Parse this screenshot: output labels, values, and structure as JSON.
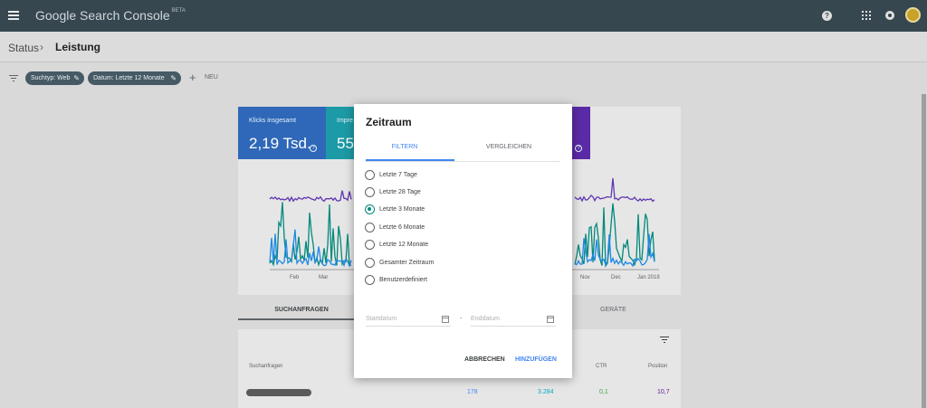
{
  "app": {
    "title": "Google Search Console",
    "beta": "BETA"
  },
  "breadcrumb": {
    "parent": "Status",
    "separator": "›",
    "current": "Leistung"
  },
  "filters": {
    "chips": [
      {
        "label": "Suchtyp: Web"
      },
      {
        "label": "Datum: Letzte 12 Monate"
      }
    ],
    "add_label": "NEU"
  },
  "metrics": [
    {
      "label": "Klicks insgesamt",
      "value": "2,19 Tsd.",
      "color": "#4285f4"
    },
    {
      "label": "Impre",
      "value": "55",
      "color": "#00acc1"
    }
  ],
  "chart_data": {
    "type": "line",
    "x_tick_labels": [
      "Feb",
      "Mar",
      "Nov",
      "Dec",
      "Jan 2018"
    ],
    "series": [
      {
        "color": "#5e35b1"
      },
      {
        "color": "#00897b"
      },
      {
        "color": "#1e88e5"
      }
    ]
  },
  "table_section": {
    "tabs": {
      "queries": "SUCHANFRAGEN",
      "devices": "GERÄTE"
    },
    "columns": {
      "query": "Suchanfragen",
      "ctr": "CTR",
      "position": "Position"
    },
    "first_row": {
      "clicks": "178",
      "impressions": "3.284",
      "ctr": "0,1",
      "position": "10,7"
    }
  },
  "modal": {
    "title": "Zeitraum",
    "tabs": {
      "filter": "FILTERN",
      "compare": "VERGLEICHEN"
    },
    "options": [
      {
        "label": "Letzte 7 Tage",
        "selected": false
      },
      {
        "label": "Letzte 28 Tage",
        "selected": false
      },
      {
        "label": "Letzte 3 Monate",
        "selected": true
      },
      {
        "label": "Letzte 6 Monate",
        "selected": false
      },
      {
        "label": "Letzte 12 Monate",
        "selected": false
      },
      {
        "label": "Gesamter Zeitraum",
        "selected": false
      },
      {
        "label": "Benutzerdefiniert",
        "selected": false
      }
    ],
    "start_placeholder": "Startdatum",
    "end_placeholder": "Enddatum",
    "date_separator": "-",
    "cancel_label": "ABBRECHEN",
    "add_label": "HINZUFÜGEN"
  },
  "colors": {
    "accent": "#4285f4",
    "radio_checked": "#00897b",
    "app_bar": "#37474f"
  }
}
